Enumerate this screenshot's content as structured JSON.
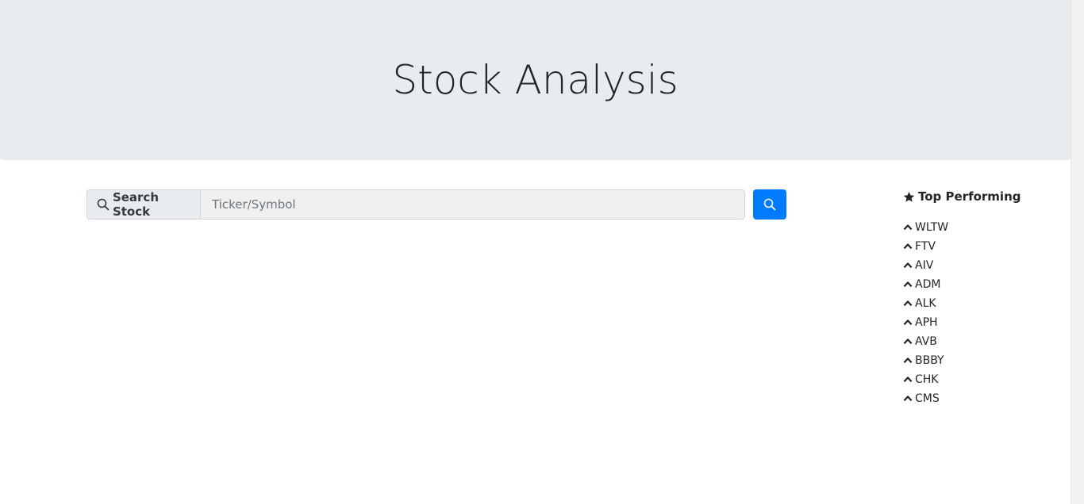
{
  "header": {
    "title": "Stock Analysis"
  },
  "search": {
    "label": "Search Stock",
    "placeholder": "Ticker/Symbol",
    "value": "",
    "label_icon": "search-icon",
    "button_icon": "search-icon"
  },
  "sidebar": {
    "title": "Top Performing",
    "title_icon": "star-icon",
    "item_icon": "chevron-up-icon",
    "items": [
      "WLTW",
      "FTV",
      "AIV",
      "ADM",
      "ALK",
      "APH",
      "AVB",
      "BBBY",
      "CHK",
      "CMS"
    ]
  },
  "colors": {
    "accent": "#007bff",
    "header_bg": "#e9ecef"
  }
}
